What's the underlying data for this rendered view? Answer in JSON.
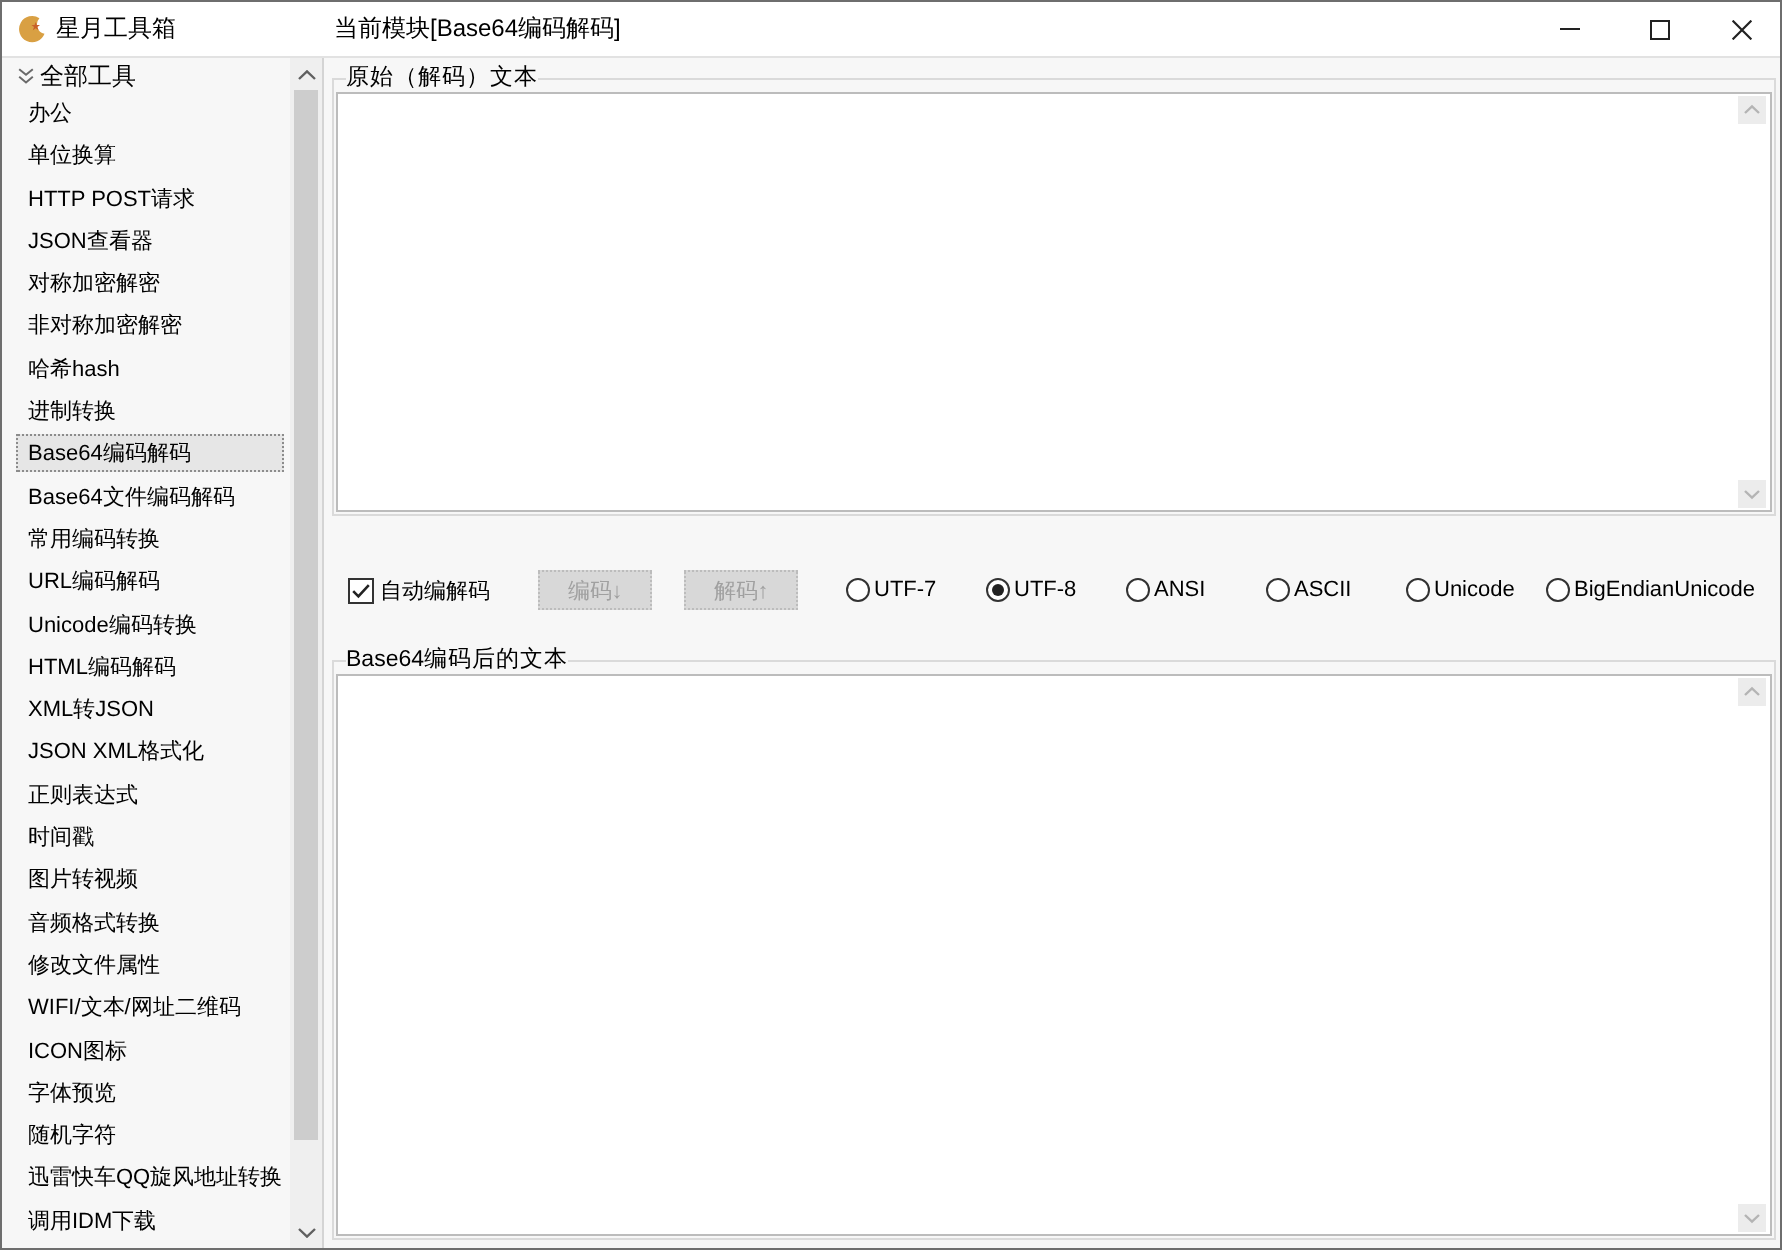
{
  "window": {
    "title": "星月工具箱",
    "module_title": "当前模块[Base64编码解码]"
  },
  "sidebar": {
    "tree": [
      {
        "label": "全部工具",
        "selected": false,
        "expanded": true,
        "children": [
          {
            "label": "办公",
            "selected": false
          },
          {
            "label": "单位换算",
            "selected": false
          },
          {
            "label": "HTTP POST请求",
            "selected": false
          },
          {
            "label": "JSON查看器",
            "selected": false
          },
          {
            "label": "对称加密解密",
            "selected": false
          },
          {
            "label": "非对称加密解密",
            "selected": false
          },
          {
            "label": "哈希hash",
            "selected": false
          },
          {
            "label": "进制转换",
            "selected": false
          },
          {
            "label": "Base64编码解码",
            "selected": true
          },
          {
            "label": "Base64文件编码解码",
            "selected": false
          },
          {
            "label": "常用编码转换",
            "selected": false
          },
          {
            "label": "URL编码解码",
            "selected": false
          },
          {
            "label": "Unicode编码转换",
            "selected": false
          },
          {
            "label": "HTML编码解码",
            "selected": false
          },
          {
            "label": "XML转JSON",
            "selected": false
          },
          {
            "label": "JSON XML格式化",
            "selected": false
          },
          {
            "label": "正则表达式",
            "selected": false
          },
          {
            "label": "时间戳",
            "selected": false
          },
          {
            "label": "图片转视频",
            "selected": false
          },
          {
            "label": "音频格式转换",
            "selected": false
          },
          {
            "label": "修改文件属性",
            "selected": false
          },
          {
            "label": "WIFI/文本/网址二维码",
            "selected": false
          },
          {
            "label": "ICON图标",
            "selected": false
          },
          {
            "label": "字体预览",
            "selected": false
          },
          {
            "label": "随机字符",
            "selected": false
          },
          {
            "label": "迅雷快车QQ旋风地址转换",
            "selected": false
          },
          {
            "label": "调用IDM下载",
            "selected": false
          }
        ]
      }
    ]
  },
  "source_panel": {
    "label": "原始（解码）文本"
  },
  "options": {
    "auto_codec": {
      "label": "自动编解码",
      "checked": true
    },
    "buttons": [
      {
        "label": "编码↓",
        "disabled": true
      },
      {
        "label": "解码↑",
        "disabled": true
      }
    ],
    "encodings": [
      {
        "label": "UTF-7",
        "selected": false
      },
      {
        "label": "UTF-8",
        "selected": true
      },
      {
        "label": "ANSI",
        "selected": false
      },
      {
        "label": "ASCII",
        "selected": false
      },
      {
        "label": "Unicode",
        "selected": false
      },
      {
        "label": "BigEndianUnicode",
        "selected": false
      }
    ]
  },
  "result_panel": {
    "label": "Base64编码后的文本"
  }
}
